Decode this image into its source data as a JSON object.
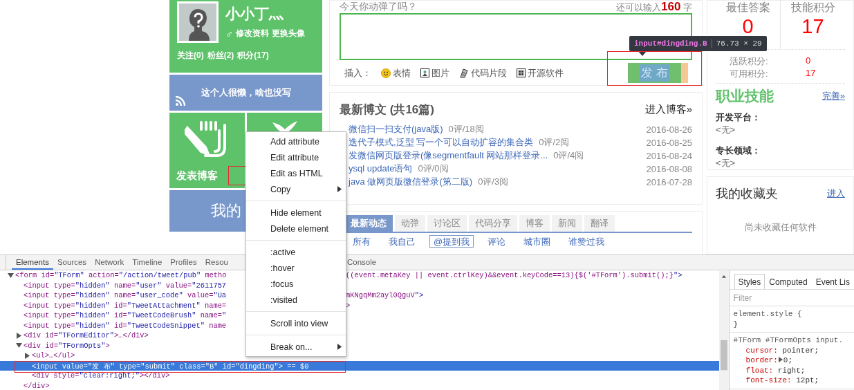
{
  "profile": {
    "name": "小小丁灬",
    "gender_symbol": "♂",
    "links": [
      "修改资料",
      "更换头像"
    ],
    "stats": [
      "关注(0)",
      "粉丝(2)",
      "积分(17)"
    ]
  },
  "motto": "这个人很懒，啥也没写",
  "tiles": [
    {
      "kind": "blog",
      "label": "发表博客"
    },
    {
      "kind": "other"
    }
  ],
  "my_bar": "我的",
  "tweet_box": {
    "prompt": "今天你动弹了吗？",
    "remaining_prefix": "还可以输入",
    "remaining": "160",
    "remaining_suffix": "字",
    "insert_label": "插入：",
    "insert_options": [
      {
        "kind": "emoji",
        "label": "表情"
      },
      {
        "kind": "image",
        "label": "图片"
      },
      {
        "kind": "code",
        "label": "代码片段"
      },
      {
        "kind": "software",
        "label": "开源软件"
      }
    ],
    "submit": "发 布"
  },
  "tooltip": {
    "selector": "input#dingding.B",
    "size": "76.73 × 29"
  },
  "blog": {
    "title": "最新博文 (共16篇)",
    "link": "进入博客»",
    "posts": [
      {
        "title": "微信扫一扫支付(java版)",
        "stats": "0评/18阅",
        "date": "2016-08-26"
      },
      {
        "title": "迭代子模式,泛型 写一个可以自动扩容的集合类",
        "stats": "0评/2阅",
        "date": "2016-08-25"
      },
      {
        "title": "发微信网页版登录(像segmentfault 网站那样登录...",
        "stats": "0评/4阅",
        "date": "2016-08-24"
      },
      {
        "title": "ysql update语句",
        "stats": "0评/0阅",
        "date": "2016-08-08"
      },
      {
        "title": "java 做网页版微信登录(第二版)",
        "stats": "0评/3阅",
        "date": "2016-07-28"
      }
    ]
  },
  "activity": {
    "tabs": [
      {
        "label": "最新动态",
        "selected": true
      },
      {
        "label": "动弹",
        "selected": false
      },
      {
        "label": "讨论区",
        "selected": false
      },
      {
        "label": "代码分享",
        "selected": false
      },
      {
        "label": "博客",
        "selected": false
      },
      {
        "label": "新闻",
        "selected": false
      },
      {
        "label": "翻译",
        "selected": false
      }
    ],
    "filters": [
      {
        "label": "所有",
        "selected": false
      },
      {
        "label": "我自己",
        "selected": false
      },
      {
        "label": "@提到我",
        "selected": true
      },
      {
        "label": "评论",
        "selected": false
      },
      {
        "label": "城市圈",
        "selected": false
      },
      {
        "label": "谁赞过我",
        "selected": false
      }
    ]
  },
  "scores": {
    "items": [
      {
        "label": "最佳答案",
        "value": "0"
      },
      {
        "label": "技能积分",
        "value": "17"
      }
    ],
    "details": [
      {
        "label": "活跃积分:",
        "value": "0"
      },
      {
        "label": "可用积分:",
        "value": "17"
      }
    ]
  },
  "skills": {
    "title": "职业技能",
    "link": "完善»",
    "fields": [
      {
        "label": "开发平台：",
        "value": "<无>"
      },
      {
        "label": "专长领域：",
        "value": "<无>"
      }
    ]
  },
  "favorites": {
    "title": "我的收藏夹",
    "link": "进入",
    "empty": "尚未收藏任何软件"
  },
  "devtools": {
    "tabs": [
      {
        "label": "Elements",
        "selected": true
      },
      {
        "label": "Sources",
        "selected": false
      },
      {
        "label": "Network",
        "selected": false
      },
      {
        "label": "Timeline",
        "selected": false
      },
      {
        "label": "Profiles",
        "selected": false
      },
      {
        "label": "Resou",
        "selected": false
      },
      {
        "label": "Console",
        "selected": false
      }
    ],
    "dom": [
      {
        "text": "<form id=\"TForm\" action=\"/action/tweet/pub\" metho",
        "tail": "((event.metaKey || event.ctrlKey)&&event.keyCode==13){$('#TForm').submit();}\">",
        "expanded": true,
        "selected": false,
        "children": [
          {
            "text": "<input type=\"hidden\" name=\"user\" value=\"2611757",
            "selected": false
          },
          {
            "text": "<input type=\"hidden\" name=\"user_code\" value=\"Ua",
            "tail": "mKNgqMm2ayl0QguV\">",
            "selected": false
          },
          {
            "text": "<input type=\"hidden\" id=\"TweetAttachment\" name=",
            "tail": ">",
            "selected": false
          },
          {
            "text": "<input type=\"hidden\" id=\"TweetCodeBrush\" name=\"",
            "selected": false
          },
          {
            "text": "<input type=\"hidden\" id=\"TweetCodeSnippet\" name",
            "selected": false
          },
          {
            "text": "<div id=\"TFormEditor\">…</div>",
            "expanded": false,
            "selected": false
          },
          {
            "text": "<div id=\"TFormOpts\">",
            "expanded": true,
            "selected": false,
            "close": "</div>",
            "children": [
              {
                "text": "<ul>…</ul>",
                "expanded": false,
                "selected": false
              },
              {
                "text": "<input value=\"发 布\" type=\"submit\" class=\"B\" id=\"dingding\"> == $0",
                "selected": true
              },
              {
                "text": "<div style=\"clear:right;\"></div>",
                "selected": false
              }
            ]
          }
        ]
      }
    ],
    "styles": {
      "tabs": [
        {
          "label": "Styles",
          "selected": true
        },
        {
          "label": "Computed",
          "selected": false
        },
        {
          "label": "Event Lis",
          "selected": false
        }
      ],
      "filter_placeholder": "Filter",
      "rules": [
        {
          "selector": "element.style {",
          "close": "}"
        },
        {
          "selector": "#TForm #TFormOpts input.",
          "properties": [
            {
              "name": "cursor:",
              "value": "pointer;",
              "expandable": false
            },
            {
              "name": "border:",
              "value": "0;",
              "expandable": true
            },
            {
              "name": "float:",
              "value": "right;",
              "expandable": false
            },
            {
              "name": "font-size:",
              "value": "12pt;",
              "expandable": false
            }
          ]
        }
      ]
    }
  },
  "context_menu": [
    {
      "kind": "item",
      "label": "Add attribute",
      "submenu": false
    },
    {
      "kind": "item",
      "label": "Edit attribute",
      "submenu": false
    },
    {
      "kind": "item",
      "label": "Edit as HTML",
      "submenu": false
    },
    {
      "kind": "item",
      "label": "Copy",
      "submenu": true
    },
    {
      "kind": "separator"
    },
    {
      "kind": "item",
      "label": "Hide element",
      "submenu": false
    },
    {
      "kind": "item",
      "label": "Delete element",
      "submenu": false
    },
    {
      "kind": "separator"
    },
    {
      "kind": "item",
      "label": ":active",
      "submenu": false
    },
    {
      "kind": "item",
      "label": ":hover",
      "submenu": false
    },
    {
      "kind": "item",
      "label": ":focus",
      "submenu": false
    },
    {
      "kind": "item",
      "label": ":visited",
      "submenu": false
    },
    {
      "kind": "separator"
    },
    {
      "kind": "item",
      "label": "Scroll into view",
      "submenu": false
    },
    {
      "kind": "separator"
    },
    {
      "kind": "item",
      "label": "Break on...",
      "submenu": true
    }
  ]
}
